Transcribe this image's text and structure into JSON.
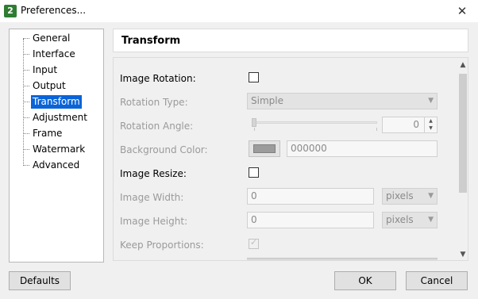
{
  "window": {
    "title": "Preferences...",
    "app_icon_glyph": "2"
  },
  "tree": {
    "items": [
      {
        "label": "General"
      },
      {
        "label": "Interface"
      },
      {
        "label": "Input"
      },
      {
        "label": "Output"
      },
      {
        "label": "Transform",
        "selected": true
      },
      {
        "label": "Adjustment"
      },
      {
        "label": "Frame"
      },
      {
        "label": "Watermark"
      },
      {
        "label": "Advanced"
      }
    ]
  },
  "panel": {
    "title": "Transform",
    "image_rotation": {
      "label": "Image Rotation:",
      "checked": false
    },
    "rotation_type": {
      "label": "Rotation Type:",
      "value": "Simple"
    },
    "rotation_angle": {
      "label": "Rotation Angle:",
      "value": "0"
    },
    "background_color": {
      "label": "Background Color:",
      "value": "000000",
      "swatch": "#9c9c9c"
    },
    "image_resize": {
      "label": "Image Resize:",
      "checked": false
    },
    "image_width": {
      "label": "Image Width:",
      "value": "0",
      "unit": "pixels"
    },
    "image_height": {
      "label": "Image Height:",
      "value": "0",
      "unit": "pixels"
    },
    "keep_proportions": {
      "label": "Keep Proportions:",
      "checked": true
    }
  },
  "buttons": {
    "defaults": "Defaults",
    "ok": "OK",
    "cancel": "Cancel"
  },
  "colors": {
    "selection": "#0a64d8",
    "disabled_text": "#9a9a9a"
  }
}
